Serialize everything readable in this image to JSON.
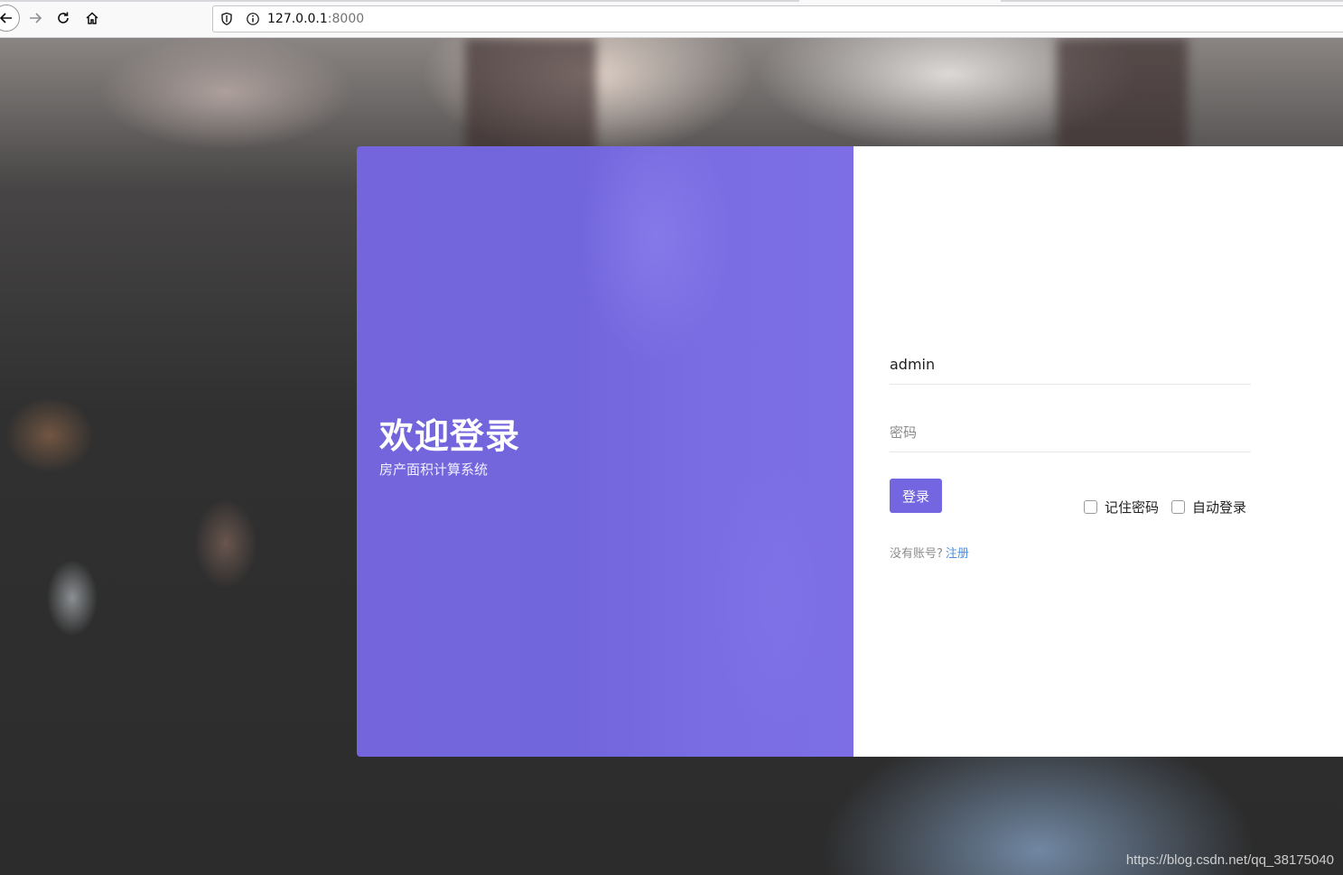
{
  "browser": {
    "url_host": "127.0.0.1",
    "url_port": ":8000"
  },
  "welcome": {
    "title": "欢迎登录",
    "subtitle": "房产面积计算系统"
  },
  "form": {
    "username_value": "admin",
    "password_placeholder": "密码",
    "login_label": "登录",
    "remember_label": "记住密码",
    "auto_login_label": "自动登录",
    "no_account_text": "没有账号?",
    "register_link": "注册"
  },
  "colors": {
    "accent": "#7466e0",
    "link": "#4a90e2"
  },
  "watermark": "https://blog.csdn.net/qq_38175040"
}
